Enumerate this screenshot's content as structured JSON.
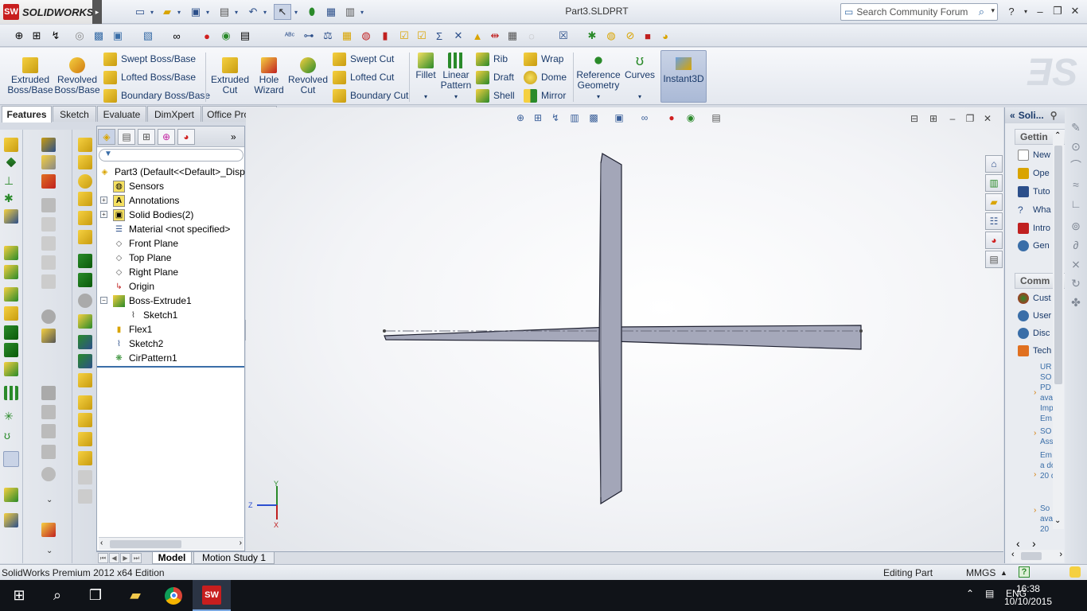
{
  "app": {
    "logo_badge": "SW",
    "logo_text": "SOLIDWORKS",
    "document_title": "Part3.SLDPRT",
    "search_placeholder": "Search Community Forum",
    "help_label": "?",
    "menu_arrow": "▸"
  },
  "command_manager": {
    "extruded_boss": "Extruded Boss/Base",
    "revolved_boss": "Revolved Boss/Base",
    "swept_boss": "Swept Boss/Base",
    "lofted_boss": "Lofted Boss/Base",
    "boundary_boss": "Boundary Boss/Base",
    "extruded_cut": "Extruded Cut",
    "hole_wizard": "Hole Wizard",
    "revolved_cut": "Revolved Cut",
    "swept_cut": "Swept Cut",
    "lofted_cut": "Lofted Cut",
    "boundary_cut": "Boundary Cut",
    "fillet": "Fillet",
    "linear_pattern": "Linear Pattern",
    "rib": "Rib",
    "draft": "Draft",
    "shell": "Shell",
    "wrap": "Wrap",
    "dome": "Dome",
    "mirror": "Mirror",
    "reference_geometry": "Reference Geometry",
    "curves": "Curves",
    "instant3d": "Instant3D"
  },
  "tabs": [
    "Features",
    "Sketch",
    "Evaluate",
    "DimXpert",
    "Office Products"
  ],
  "feature_tree": {
    "root": "Part3  (Default<<Default>_Disp",
    "items": [
      "Sensors",
      "Annotations",
      "Solid Bodies(2)",
      "Material <not specified>",
      "Front Plane",
      "Top Plane",
      "Right Plane",
      "Origin",
      "Boss-Extrude1",
      "Sketch1",
      "Flex1",
      "Sketch2",
      "CirPattern1"
    ],
    "expand_plus": "+",
    "expand_minus": "−"
  },
  "triad": {
    "y": "Y",
    "z": "Z",
    "x": "X"
  },
  "task_pane": {
    "header": "Soli...",
    "getting_started": "Gettin",
    "getting_items": [
      "New",
      "Ope",
      "Tuto",
      "Wha",
      "Intro",
      "Gen"
    ],
    "community": "Comm",
    "community_items": [
      "Cust",
      "User",
      "Disc",
      "Tech"
    ],
    "news": [
      "UR SO PD ava Imp Em",
      "SO Ass",
      "Em is a dov 20 do.",
      "So ava 20"
    ],
    "news_bullet": "›"
  },
  "bottom_tabs": [
    "Model",
    "Motion Study 1"
  ],
  "status_bar": {
    "edition": "SolidWorks Premium 2012 x64 Edition",
    "mode": "Editing Part",
    "units": "MMGS",
    "units_arrow": "▲",
    "help": "?"
  },
  "taskbar": {
    "language": "ENG",
    "time": "16:38",
    "date": "10/10/2015"
  },
  "colors": {
    "accent": "#c81e1e",
    "part_fill": "#a3a6b8",
    "part_edge": "#1e2030"
  }
}
